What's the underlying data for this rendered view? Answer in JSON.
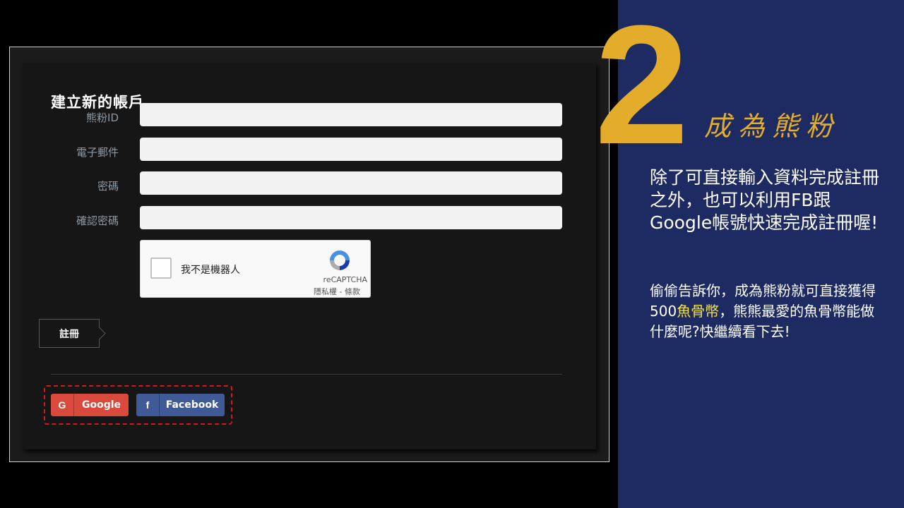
{
  "form": {
    "title": "建立新的帳戶。",
    "fields": [
      {
        "label": "熊粉ID",
        "value": ""
      },
      {
        "label": "電子郵件",
        "value": ""
      },
      {
        "label": "密碼",
        "value": ""
      },
      {
        "label": "確認密碼",
        "value": ""
      }
    ],
    "recaptcha": {
      "checkbox_label": "我不是機器人",
      "brand": "reCAPTCHA",
      "links": "隱私權 - 條款"
    },
    "submit_label": "註冊",
    "social": {
      "google_icon": "G",
      "google_label": "Google",
      "facebook_icon": "f",
      "facebook_label": "Facebook"
    }
  },
  "slide": {
    "step_number": "2",
    "step_title": "成為熊粉",
    "paragraph1": "除了可直接輸入資料完成註冊之外，也可以利用FB跟Google帳號快速完成註冊喔!",
    "paragraph2_before": "偷偷告訴你，成為熊粉就可直接獲得500",
    "paragraph2_highlight": "魚骨幣",
    "paragraph2_after": "，熊熊最愛的魚骨幣能做什麼呢?快繼續看下去!"
  },
  "colors": {
    "accent_gold": "#e3ac2b",
    "right_background": "#1e2b62",
    "highlight_yellow": "#f5e33a",
    "google_red": "#d94a3c",
    "facebook_blue": "#3f5a96",
    "dashed_outline_red": "#d6151c"
  }
}
